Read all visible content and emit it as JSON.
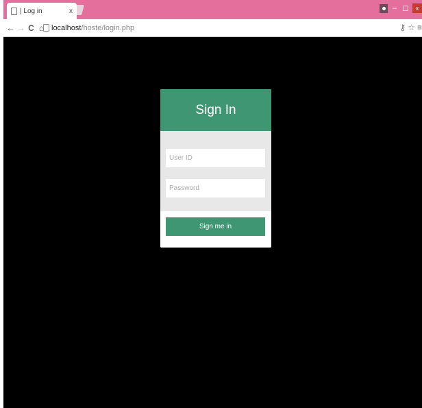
{
  "browser": {
    "tab_title": "| Log in",
    "tab_close": "x",
    "url_host": "localhost",
    "url_path": "/hoste/login.php",
    "accent_color": "#e46f9c"
  },
  "nav": {
    "back": "←",
    "forward": "→",
    "reload": "C",
    "home": "⌂"
  },
  "window_controls": {
    "minimize": "–",
    "restore": "◻",
    "close": "x"
  },
  "toolbar_right": {
    "key": "⚷",
    "star": "☆",
    "menu": "≡"
  },
  "login": {
    "title": "Sign In",
    "user_placeholder": "User ID",
    "password_placeholder": "Password",
    "submit_label": "Sign me in",
    "brand_color": "#3e9772"
  }
}
